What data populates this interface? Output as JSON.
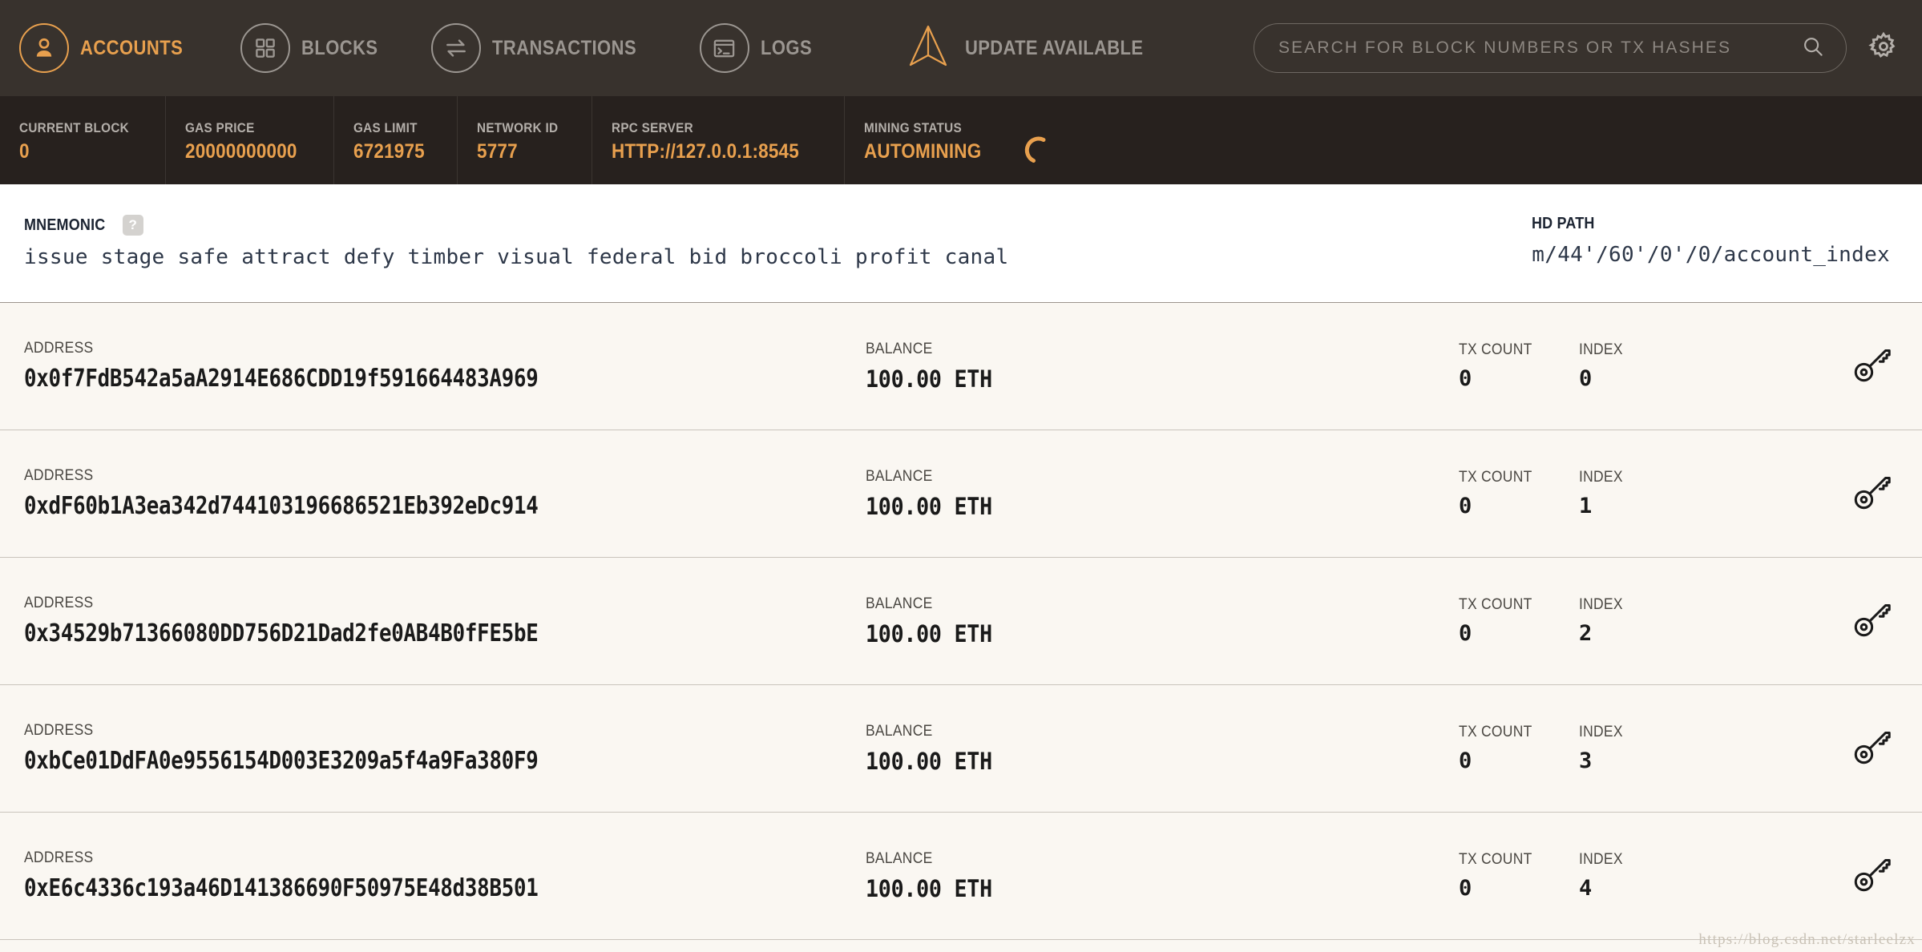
{
  "nav": {
    "items": [
      {
        "label": "ACCOUNTS",
        "icon": "user-icon",
        "active": true
      },
      {
        "label": "BLOCKS",
        "icon": "blocks-icon",
        "active": false
      },
      {
        "label": "TRANSACTIONS",
        "icon": "transactions-icon",
        "active": false
      },
      {
        "label": "LOGS",
        "icon": "logs-icon",
        "active": false
      }
    ],
    "update": {
      "label": "UPDATE AVAILABLE",
      "icon": "ganache-logo-icon"
    },
    "search": {
      "placeholder": "SEARCH FOR BLOCK NUMBERS OR TX HASHES",
      "value": "",
      "icon": "search-icon"
    },
    "settings": {
      "icon": "gear-icon"
    }
  },
  "status": {
    "cells": [
      {
        "label": "CURRENT BLOCK",
        "value": "0"
      },
      {
        "label": "GAS PRICE",
        "value": "20000000000"
      },
      {
        "label": "GAS LIMIT",
        "value": "6721975"
      },
      {
        "label": "NETWORK ID",
        "value": "5777"
      },
      {
        "label": "RPC SERVER",
        "value": "HTTP://127.0.0.1:8545"
      },
      {
        "label": "MINING STATUS",
        "value": "AUTOMINING"
      }
    ],
    "spinner_icon": "loading-spinner-icon"
  },
  "mnemonic": {
    "label": "MNEMONIC",
    "help": "?",
    "value": "issue stage safe attract defy timber visual federal bid broccoli profit canal"
  },
  "hdpath": {
    "label": "HD PATH",
    "value": "m/44'/60'/0'/0/account_index"
  },
  "columns": {
    "address": "ADDRESS",
    "balance": "BALANCE",
    "tx_count": "TX COUNT",
    "index": "INDEX"
  },
  "accounts": [
    {
      "address": "0x0f7FdB542a5aA2914E686CDD19f591664483A969",
      "balance": "100.00 ETH",
      "tx_count": "0",
      "index": "0",
      "key_icon": "key-icon"
    },
    {
      "address": "0xdF60b1A3ea342d744103196686521Eb392eDc914",
      "balance": "100.00 ETH",
      "tx_count": "0",
      "index": "1",
      "key_icon": "key-icon"
    },
    {
      "address": "0x34529b71366080DD756D21Dad2fe0AB4B0fFE5bE",
      "balance": "100.00 ETH",
      "tx_count": "0",
      "index": "2",
      "key_icon": "key-icon"
    },
    {
      "address": "0xbCe01DdFA0e9556154D003E3209a5f4a9Fa380F9",
      "balance": "100.00 ETH",
      "tx_count": "0",
      "index": "3",
      "key_icon": "key-icon"
    },
    {
      "address": "0xE6c4336c193a46D141386690F50975E48d38B501",
      "balance": "100.00 ETH",
      "tx_count": "0",
      "index": "4",
      "key_icon": "key-icon"
    }
  ],
  "watermark": "https://blog.csdn.net/starleelzx",
  "colors": {
    "nav_bg": "#38322d",
    "status_bg": "#27211e",
    "accent": "#e8a04e",
    "muted_text": "#9b9691",
    "panel_bg": "#ffffff",
    "row_bg": "#faf7f2",
    "row_border": "#c9c4bc",
    "mono_text": "#2d3748"
  }
}
